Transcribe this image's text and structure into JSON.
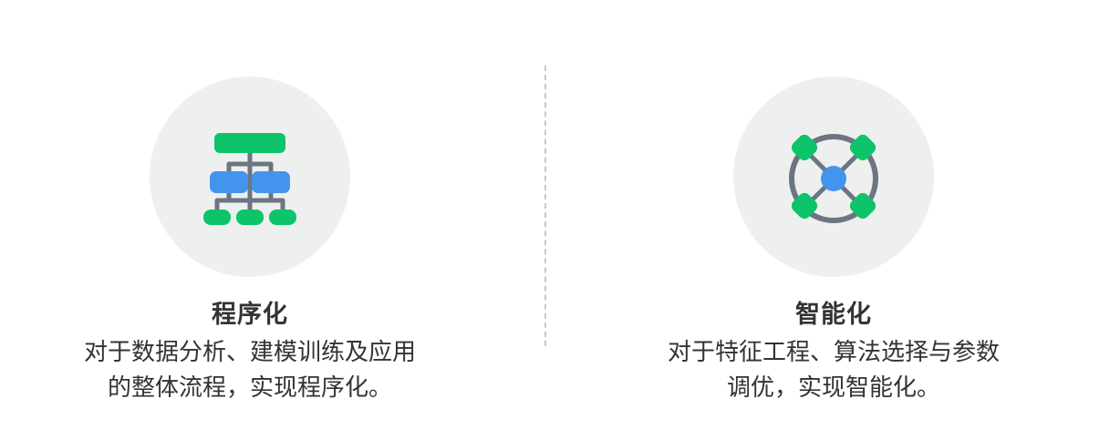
{
  "features": [
    {
      "icon": "hierarchy-icon",
      "title": "程序化",
      "description_lines": [
        "对于数据分析、建模训练及应用",
        "的整体流程，实现程序化。"
      ]
    },
    {
      "icon": "network-hub-icon",
      "title": "智能化",
      "description_lines": [
        "对于特征工程、算法选择与参数",
        "调优，实现智能化。"
      ]
    }
  ],
  "colors": {
    "green": "#0dc46a",
    "blue": "#4394ef",
    "gray": "#6b7584",
    "circle_bg": "#eef0ef",
    "text": "#333333"
  }
}
